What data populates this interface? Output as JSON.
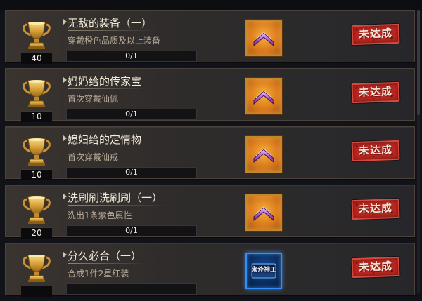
{
  "achievements": [
    {
      "title": "无敌的装备（一）",
      "description": "穿戴橙色品质及以上装备",
      "points": "40",
      "progress": {
        "text": "0/1",
        "current": 0,
        "total": 1
      },
      "reward": {
        "frame": "orange",
        "icon": "purple-chevron-badge-icon",
        "label": ""
      },
      "status": "未达成"
    },
    {
      "title": "妈妈给的传家宝",
      "description": "首次穿戴仙佩",
      "points": "10",
      "progress": {
        "text": "0/1",
        "current": 0,
        "total": 1
      },
      "reward": {
        "frame": "orange",
        "icon": "purple-chevron-badge-icon",
        "label": ""
      },
      "status": "未达成"
    },
    {
      "title": "媳妇给的定情物",
      "description": "首次穿戴仙戒",
      "points": "10",
      "progress": {
        "text": "0/1",
        "current": 0,
        "total": 1
      },
      "reward": {
        "frame": "orange",
        "icon": "purple-chevron-badge-icon",
        "label": ""
      },
      "status": "未达成"
    },
    {
      "title": "洗刷刷洗刷刷（一）",
      "description": "洗出1条紫色属性",
      "points": "20",
      "progress": {
        "text": "0/1",
        "current": 0,
        "total": 1
      },
      "reward": {
        "frame": "orange",
        "icon": "purple-chevron-badge-icon",
        "label": ""
      },
      "status": "未达成"
    },
    {
      "title": "分久必合（一）",
      "description": "合成1件2星红装",
      "points": "",
      "progress": {
        "text": "",
        "current": 0,
        "total": 1
      },
      "reward": {
        "frame": "blue",
        "icon": "title-plaque-icon",
        "label": "鬼斧神工"
      },
      "status": "未达成"
    }
  ],
  "colors": {
    "stamp_red": "#b9261f",
    "orange_frame": "#d8771a",
    "blue_frame": "#2e90ff",
    "trophy_gold": "#e0b24a"
  }
}
